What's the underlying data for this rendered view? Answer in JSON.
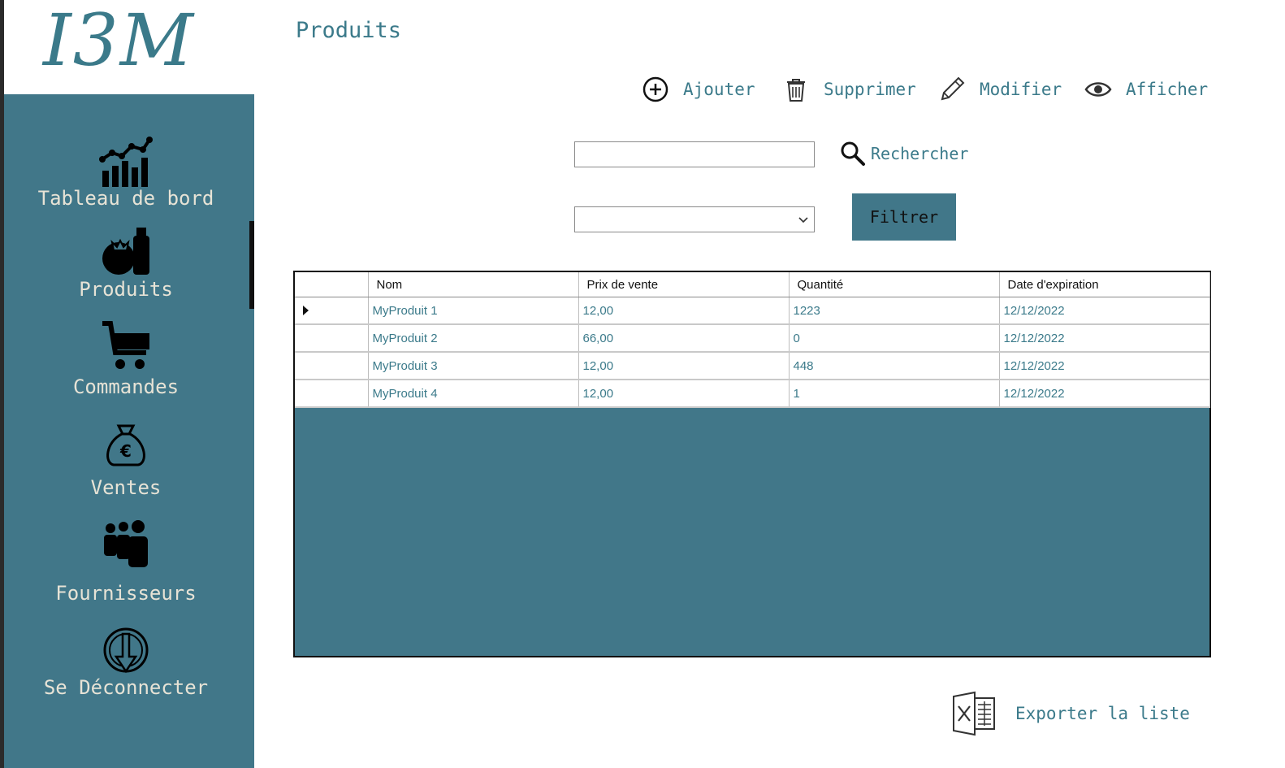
{
  "app": {
    "logo": "I3M"
  },
  "sidebar": {
    "items": [
      {
        "label": "Tableau de bord",
        "icon": "chart-bar-icon"
      },
      {
        "label": "Produits",
        "icon": "products-icon",
        "active": true
      },
      {
        "label": "Commandes",
        "icon": "cart-icon"
      },
      {
        "label": "Ventes",
        "icon": "money-bag-euro-icon"
      },
      {
        "label": "Fournisseurs",
        "icon": "people-icon"
      },
      {
        "label": "Se Déconnecter",
        "icon": "logout-icon"
      }
    ]
  },
  "page": {
    "title": "Produits"
  },
  "toolbar": {
    "add": "Ajouter",
    "delete": "Supprimer",
    "edit": "Modifier",
    "view": "Afficher"
  },
  "search": {
    "value": "",
    "button": "Rechercher"
  },
  "filter": {
    "selected": "",
    "button": "Filtrer"
  },
  "table": {
    "columns": [
      "Nom",
      "Prix de vente",
      "Quantité",
      "Date d'expiration"
    ],
    "rows": [
      {
        "nom": "MyProduit 1",
        "prix": "12,00",
        "quantite": "1223",
        "date": "12/12/2022"
      },
      {
        "nom": "MyProduit 2",
        "prix": "66,00",
        "quantite": "0",
        "date": "12/12/2022"
      },
      {
        "nom": "MyProduit 3",
        "prix": "12,00",
        "quantite": "448",
        "date": "12/12/2022"
      },
      {
        "nom": "MyProduit 4",
        "prix": "12,00",
        "quantite": "1",
        "date": "12/12/2022"
      }
    ],
    "selected_row": 0
  },
  "export": {
    "label": "Exporter la liste"
  },
  "colors": {
    "accent": "#417789",
    "text_accent": "#3b7a8a",
    "sidebar_text": "#e7e3d6"
  }
}
